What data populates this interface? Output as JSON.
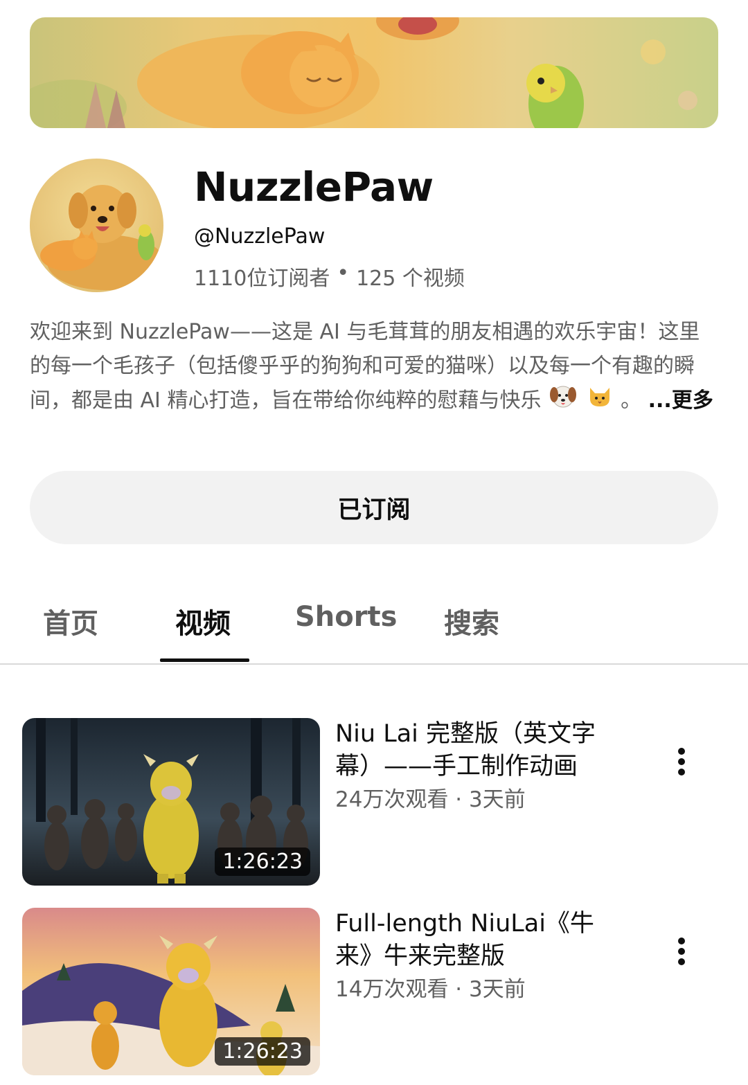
{
  "channel": {
    "name": "NuzzlePaw",
    "handle": "@NuzzlePaw",
    "subscribers": "1110位订阅者",
    "separator": "•",
    "video_count": "125 个视频",
    "description_text": "欢迎来到 NuzzlePaw——这是 AI 与毛茸茸的朋友相遇的欢乐宇宙！这里的每一个毛孩子（包括傻乎乎的狗狗和可爱的猫咪）以及每一个有趣的瞬间，都是由 AI 精心打造，旨在带给你纯粹的慰藉与快乐",
    "description_tail": "。",
    "more_label": "...更多",
    "emoji_icons": [
      "dog-face-icon",
      "cat-face-icon"
    ]
  },
  "subscribe_button": {
    "label": "已订阅"
  },
  "tabs": [
    {
      "label": "首页",
      "active": false
    },
    {
      "label": "视频",
      "active": true
    },
    {
      "label": "Shorts",
      "active": false
    },
    {
      "label": "搜索",
      "active": false
    }
  ],
  "videos": [
    {
      "title": "Niu Lai 完整版（英文字幕）——手工制作动画",
      "views": "24万次观看",
      "separator": " · ",
      "age": "3天前",
      "duration": "1:26:23"
    },
    {
      "title": "Full-length NiuLai《牛来》牛来完整版",
      "views": "14万次观看",
      "separator": " · ",
      "age": "3天前",
      "duration": "1:26:23"
    }
  ],
  "colors": {
    "text_primary": "#0f0f0f",
    "text_secondary": "#606060",
    "button_bg": "#f2f2f2",
    "divider": "#d9d9d9"
  }
}
